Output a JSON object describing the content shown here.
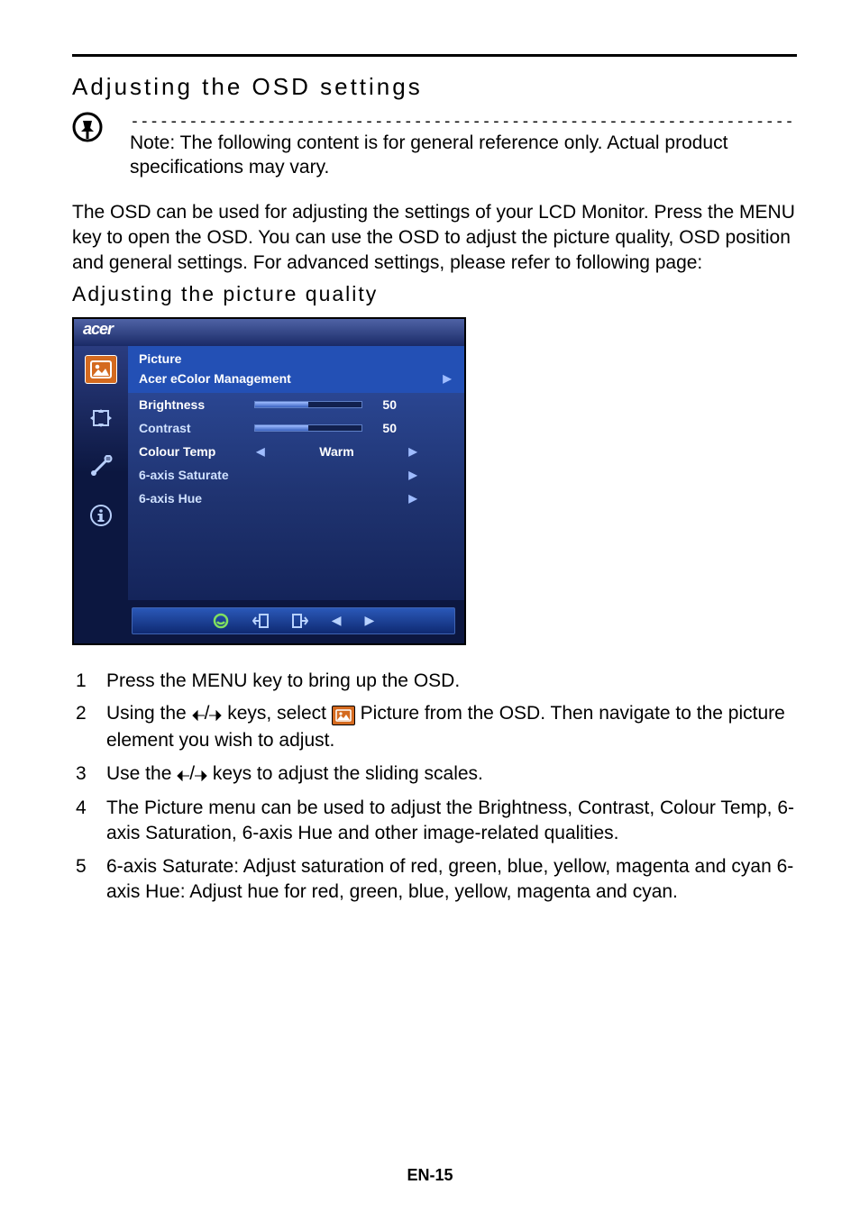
{
  "heading": "Adjusting the OSD settings",
  "note_dashes": "--------------------------------------------------------------------",
  "note_text": "Note: The following content is for general reference only. Actual product specifications may vary.",
  "description": "The OSD can be used for adjusting the settings of your LCD Monitor. Press the MENU key to open the OSD. You can use the OSD to adjust the picture quality, OSD position and general settings. For advanced settings, please refer to following page:",
  "subheading": "Adjusting the picture quality",
  "osd": {
    "brand": "acer",
    "panel_title": "Picture",
    "panel_subtitle": "Acer eColor Management",
    "items": {
      "brightness": {
        "label": "Brightness",
        "value": 50,
        "pct": 50
      },
      "contrast": {
        "label": "Contrast",
        "value": 50,
        "pct": 50
      },
      "colortemp": {
        "label": "Colour Temp",
        "value": "Warm"
      },
      "saturate": {
        "label": "6-axis Saturate"
      },
      "hue": {
        "label": "6-axis Hue"
      }
    }
  },
  "steps": [
    {
      "n": "1",
      "t": "Press the MENU key to bring up the OSD."
    },
    {
      "n": "2",
      "pre": "Using the ",
      "mid": " keys, select ",
      "post": " Picture from the OSD. Then navigate to the picture element you wish to adjust."
    },
    {
      "n": "3",
      "pre": "Use the ",
      "post": " keys to adjust the sliding scales."
    },
    {
      "n": "4",
      "t": "The Picture menu can be used to adjust the Brightness, Contrast, Colour Temp, 6-axis Saturation, 6-axis Hue and other image-related qualities."
    },
    {
      "n": "5",
      "t": "6-axis Saturate: Adjust saturation of red, green, blue, yellow, magenta and cyan 6-axis Hue: Adjust hue for red, green, blue, yellow, magenta and cyan."
    }
  ],
  "page_number": "EN-15",
  "glyphs": {
    "tri_left": "◀",
    "tri_right": "▶",
    "tri_left_sm": "◄",
    "tri_right_sm": "►",
    "slash": "/"
  },
  "chart_data": {
    "type": "bar",
    "title": "Picture OSD sliders",
    "categories": [
      "Brightness",
      "Contrast"
    ],
    "values": [
      50,
      50
    ],
    "xlabel": "",
    "ylabel": "",
    "ylim": [
      0,
      100
    ]
  }
}
